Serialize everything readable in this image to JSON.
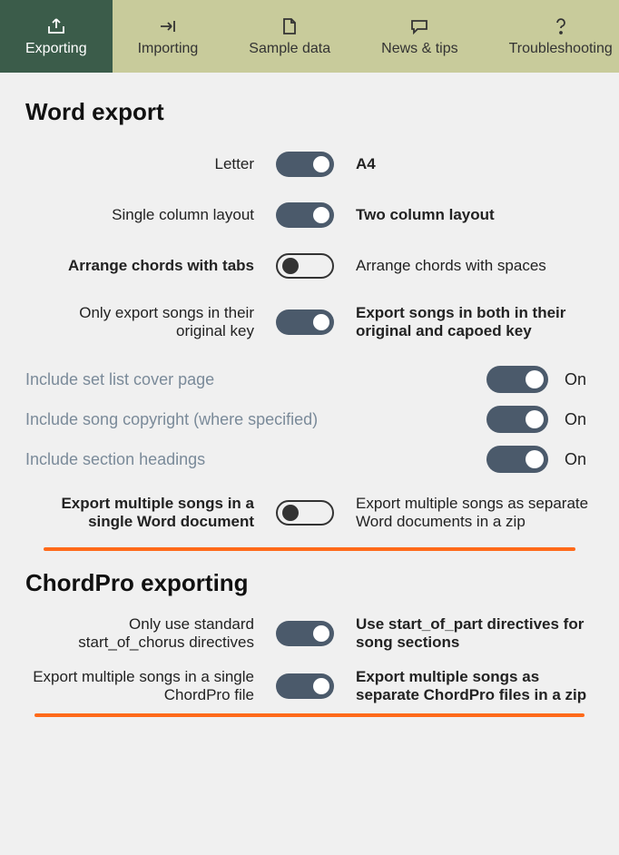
{
  "tabs": [
    {
      "label": "Exporting"
    },
    {
      "label": "Importing"
    },
    {
      "label": "Sample data"
    },
    {
      "label": "News & tips"
    },
    {
      "label": "Troubleshooting"
    }
  ],
  "word_export": {
    "title": "Word export",
    "rows": [
      {
        "left": "Letter",
        "right": "A4",
        "state": "on",
        "emph": "right"
      },
      {
        "left": "Single column layout",
        "right": "Two column layout",
        "state": "on",
        "emph": "right"
      },
      {
        "left": "Arrange chords with tabs",
        "right": "Arrange chords with spaces",
        "state": "off",
        "emph": "left"
      },
      {
        "left": "Only export songs in their original key",
        "right": "Export songs in both in their original and capoed key",
        "state": "on",
        "emph": "right"
      }
    ],
    "simple": [
      {
        "label": "Include set list cover page",
        "state": "On"
      },
      {
        "label": "Include song copyright (where specified)",
        "state": "On"
      },
      {
        "label": "Include section headings",
        "state": "On"
      }
    ],
    "rows2": [
      {
        "left": "Export multiple songs in a single Word document",
        "right": "Export multiple songs as separate Word documents in a zip",
        "state": "off",
        "emph": "left"
      }
    ]
  },
  "chordpro": {
    "title": "ChordPro exporting",
    "rows": [
      {
        "left": "Only use standard start_of_chorus directives",
        "right": "Use start_of_part directives for song sections",
        "state": "on",
        "emph": "right"
      },
      {
        "left": "Export multiple songs in a single ChordPro file",
        "right": "Export multiple songs as separate ChordPro files in a zip",
        "state": "on",
        "emph": "right"
      }
    ]
  }
}
